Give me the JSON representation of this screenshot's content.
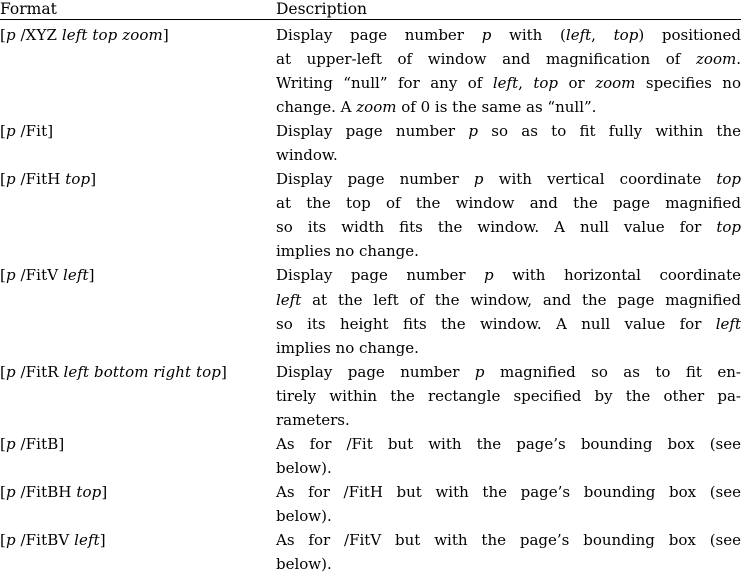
{
  "document": {
    "type": "table",
    "background": "#ffffff",
    "text_color": "#000000",
    "columns": [
      {
        "id": "format",
        "header": "Format"
      },
      {
        "id": "description",
        "header": "Description"
      }
    ],
    "rows": [
      {
        "format": "[p /XYZ left top zoom]",
        "format_parts": [
          {
            "t": "[",
            "style": "roman"
          },
          {
            "t": "p",
            "style": "italic"
          },
          {
            "t": " /XYZ ",
            "style": "roman"
          },
          {
            "t": "left top zoom",
            "style": "italic"
          },
          {
            "t": "]",
            "style": "roman"
          }
        ],
        "description": "Display page number p with (left, top) positioned at upper-left of window and magnification of zoom. Writing “null” for any of left, top or zoom specifies no change. A zoom of 0 is the same as “null”.",
        "description_lines": [
          [
            {
              "t": "Display page number ",
              "style": "roman"
            },
            {
              "t": "p",
              "style": "italic"
            },
            {
              "t": " with (",
              "style": "roman"
            },
            {
              "t": "left",
              "style": "italic"
            },
            {
              "t": ", ",
              "style": "roman"
            },
            {
              "t": "top",
              "style": "italic"
            },
            {
              "t": ") positioned",
              "style": "roman"
            }
          ],
          [
            {
              "t": "at upper-left of window and magnification of ",
              "style": "roman"
            },
            {
              "t": "zoom",
              "style": "italic"
            },
            {
              "t": ".",
              "style": "roman"
            }
          ],
          [
            {
              "t": "Writing “null” for any of ",
              "style": "roman"
            },
            {
              "t": "left",
              "style": "italic"
            },
            {
              "t": ", ",
              "style": "roman"
            },
            {
              "t": "top",
              "style": "italic"
            },
            {
              "t": " or ",
              "style": "roman"
            },
            {
              "t": "zoom",
              "style": "italic"
            },
            {
              "t": " specifies no",
              "style": "roman"
            }
          ],
          [
            {
              "t": "change. A ",
              "style": "roman"
            },
            {
              "t": "zoom",
              "style": "italic"
            },
            {
              "t": " of 0 is the same as “null”.",
              "style": "roman"
            }
          ]
        ]
      },
      {
        "format": "[p /Fit]",
        "format_parts": [
          {
            "t": "[",
            "style": "roman"
          },
          {
            "t": "p",
            "style": "italic"
          },
          {
            "t": " /Fit]",
            "style": "roman"
          }
        ],
        "description": "Display page number p so as to fit fully within the window.",
        "description_lines": [
          [
            {
              "t": "Display page number ",
              "style": "roman"
            },
            {
              "t": "p",
              "style": "italic"
            },
            {
              "t": " so as to fit fully within the",
              "style": "roman"
            }
          ],
          [
            {
              "t": "window.",
              "style": "roman"
            }
          ]
        ]
      },
      {
        "format": "[p /FitH top]",
        "format_parts": [
          {
            "t": "[",
            "style": "roman"
          },
          {
            "t": "p",
            "style": "italic"
          },
          {
            "t": " /FitH ",
            "style": "roman"
          },
          {
            "t": "top",
            "style": "italic"
          },
          {
            "t": "]",
            "style": "roman"
          }
        ],
        "description": "Display page number p with vertical coordinate top at the top of the window and the page magnified so its width fits the window. A null value for top implies no change.",
        "description_lines": [
          [
            {
              "t": "Display page number ",
              "style": "roman"
            },
            {
              "t": "p",
              "style": "italic"
            },
            {
              "t": " with vertical coordinate ",
              "style": "roman"
            },
            {
              "t": "top",
              "style": "italic"
            }
          ],
          [
            {
              "t": "at the top of the window and the page magnified",
              "style": "roman"
            }
          ],
          [
            {
              "t": "so its width fits the window.  A null value for ",
              "style": "roman"
            },
            {
              "t": "top",
              "style": "italic"
            }
          ],
          [
            {
              "t": "implies no change.",
              "style": "roman"
            }
          ]
        ]
      },
      {
        "format": "[p /FitV left]",
        "format_parts": [
          {
            "t": "[",
            "style": "roman"
          },
          {
            "t": "p",
            "style": "italic"
          },
          {
            "t": " /FitV ",
            "style": "roman"
          },
          {
            "t": "left",
            "style": "italic"
          },
          {
            "t": "]",
            "style": "roman"
          }
        ],
        "description": "Display page number p with horizontal coordinate left at the left of the window, and the page magnified so its height fits the window. A null value for left implies no change.",
        "description_lines": [
          [
            {
              "t": "Display page number ",
              "style": "roman"
            },
            {
              "t": "p",
              "style": "italic"
            },
            {
              "t": " with horizontal coordinate",
              "style": "roman"
            }
          ],
          [
            {
              "t": "left",
              "style": "italic"
            },
            {
              "t": " at the left of the window, and the page magnified",
              "style": "roman"
            }
          ],
          [
            {
              "t": "so its height fits the window.  A null value for ",
              "style": "roman"
            },
            {
              "t": "left",
              "style": "italic"
            }
          ],
          [
            {
              "t": "implies no change.",
              "style": "roman"
            }
          ]
        ]
      },
      {
        "format": "[p /FitR left bottom right top]",
        "format_parts": [
          {
            "t": "[",
            "style": "roman"
          },
          {
            "t": "p",
            "style": "italic"
          },
          {
            "t": " /FitR ",
            "style": "roman"
          },
          {
            "t": "left bottom right top",
            "style": "italic"
          },
          {
            "t": "]",
            "style": "roman"
          }
        ],
        "description": "Display page number p magnified so as to fit entirely within the rectangle specified by the other parameters.",
        "description_lines": [
          [
            {
              "t": "Display page number ",
              "style": "roman"
            },
            {
              "t": "p",
              "style": "italic"
            },
            {
              "t": " magnified so as to fit en-",
              "style": "roman"
            }
          ],
          [
            {
              "t": "tirely within the rectangle specified by the other pa-",
              "style": "roman"
            }
          ],
          [
            {
              "t": "rameters.",
              "style": "roman"
            }
          ]
        ]
      },
      {
        "format": "[p /FitB]",
        "format_parts": [
          {
            "t": "[",
            "style": "roman"
          },
          {
            "t": "p",
            "style": "italic"
          },
          {
            "t": " /FitB]",
            "style": "roman"
          }
        ],
        "description": "As for /Fit but with the page’s bounding box (see below).",
        "description_lines": [
          [
            {
              "t": "As for /Fit but with the page’s bounding box (see",
              "style": "roman"
            }
          ],
          [
            {
              "t": "below).",
              "style": "roman"
            }
          ]
        ]
      },
      {
        "format": "[p /FitBH top]",
        "format_parts": [
          {
            "t": "[",
            "style": "roman"
          },
          {
            "t": "p",
            "style": "italic"
          },
          {
            "t": " /FitBH ",
            "style": "roman"
          },
          {
            "t": "top",
            "style": "italic"
          },
          {
            "t": "]",
            "style": "roman"
          }
        ],
        "description": "As for /FitH but with the page’s bounding box (see below).",
        "description_lines": [
          [
            {
              "t": "As for /FitH but with the page’s bounding box (see",
              "style": "roman"
            }
          ],
          [
            {
              "t": "below).",
              "style": "roman"
            }
          ]
        ]
      },
      {
        "format": "[p /FitBV left]",
        "format_parts": [
          {
            "t": "[",
            "style": "roman"
          },
          {
            "t": "p",
            "style": "italic"
          },
          {
            "t": " /FitBV ",
            "style": "roman"
          },
          {
            "t": "left",
            "style": "italic"
          },
          {
            "t": "]",
            "style": "roman"
          }
        ],
        "description": "As for /FitV but with the page’s bounding box (see below).",
        "description_lines": [
          [
            {
              "t": "As for /FitV but with the page’s bounding box (see",
              "style": "roman"
            }
          ],
          [
            {
              "t": "below).",
              "style": "roman"
            }
          ]
        ]
      }
    ]
  }
}
